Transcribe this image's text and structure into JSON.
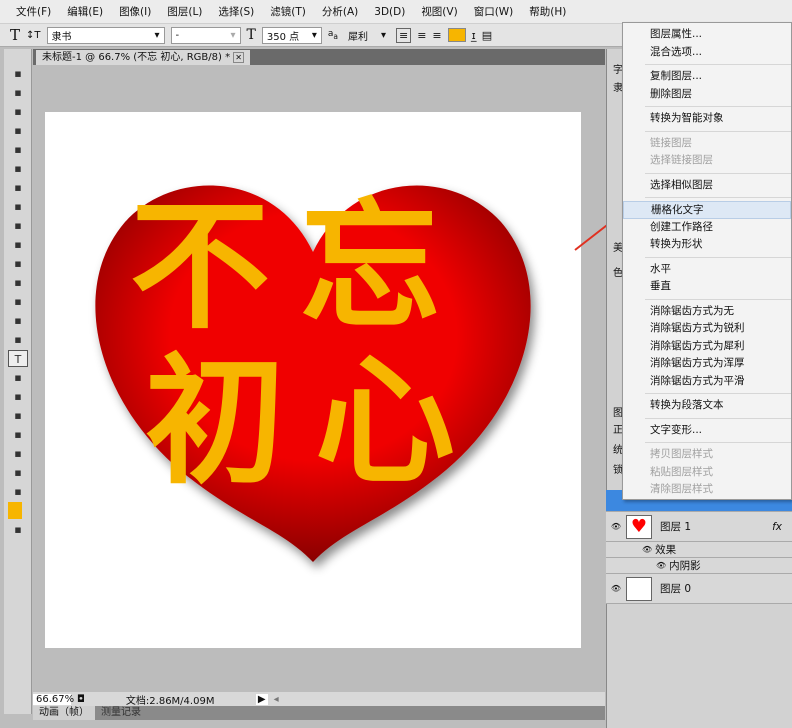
{
  "menu": [
    "文件(F)",
    "编辑(E)",
    "图像(I)",
    "图层(L)",
    "选择(S)",
    "滤镜(T)",
    "分析(A)",
    "3D(D)",
    "视图(V)",
    "窗口(W)",
    "帮助(H)"
  ],
  "options": {
    "tool_glyph": "T",
    "font_family": "隶书",
    "font_style": "-",
    "font_size": "350 点",
    "antialias": "犀利",
    "text_color": "#f7b500"
  },
  "document": {
    "tab_title": "未标题-1 @ 66.7% (不忘  初心, RGB/8) *",
    "text_line1": "不忘",
    "text_line2": "初心",
    "heart_color": "#e00000",
    "text_fill": "#f7b500"
  },
  "status": {
    "zoom": "66.67%",
    "doc_size": "文档:2.86M/4.09M"
  },
  "bottom_tabs": [
    "动画（帧）",
    "测量记录"
  ],
  "context_menu": [
    {
      "label": "图层属性...",
      "state": "enabled"
    },
    {
      "label": "混合选项...",
      "state": "enabled"
    },
    {
      "sep": true
    },
    {
      "label": "复制图层...",
      "state": "enabled"
    },
    {
      "label": "删除图层",
      "state": "enabled"
    },
    {
      "sep": true
    },
    {
      "label": "转换为智能对象",
      "state": "enabled"
    },
    {
      "sep": true
    },
    {
      "label": "链接图层",
      "state": "disabled"
    },
    {
      "label": "选择链接图层",
      "state": "disabled"
    },
    {
      "sep": true
    },
    {
      "label": "选择相似图层",
      "state": "enabled"
    },
    {
      "sep": true
    },
    {
      "label": "栅格化文字",
      "state": "highlighted"
    },
    {
      "label": "创建工作路径",
      "state": "enabled"
    },
    {
      "label": "转换为形状",
      "state": "enabled"
    },
    {
      "sep": true
    },
    {
      "label": "水平",
      "state": "enabled"
    },
    {
      "label": "垂直",
      "state": "enabled"
    },
    {
      "sep": true
    },
    {
      "label": "消除锯齿方式为无",
      "state": "enabled"
    },
    {
      "label": "消除锯齿方式为锐利",
      "state": "enabled"
    },
    {
      "label": "消除锯齿方式为犀利",
      "state": "enabled"
    },
    {
      "label": "消除锯齿方式为浑厚",
      "state": "enabled"
    },
    {
      "label": "消除锯齿方式为平滑",
      "state": "enabled"
    },
    {
      "sep": true
    },
    {
      "label": "转换为段落文本",
      "state": "enabled"
    },
    {
      "sep": true
    },
    {
      "label": "文字变形...",
      "state": "enabled"
    },
    {
      "sep": true
    },
    {
      "label": "拷贝图层样式",
      "state": "disabled"
    },
    {
      "label": "粘贴图层样式",
      "state": "disabled"
    },
    {
      "label": "清除图层样式",
      "state": "disabled"
    }
  ],
  "layers": {
    "layer1": "图层 1",
    "fx": "fx",
    "effects": "效果",
    "inner_shadow": "内阴影",
    "layer0": "图层 0"
  },
  "panel_side": [
    "字",
    "隶",
    "美",
    "色",
    "图",
    "正",
    "统",
    "锁"
  ]
}
